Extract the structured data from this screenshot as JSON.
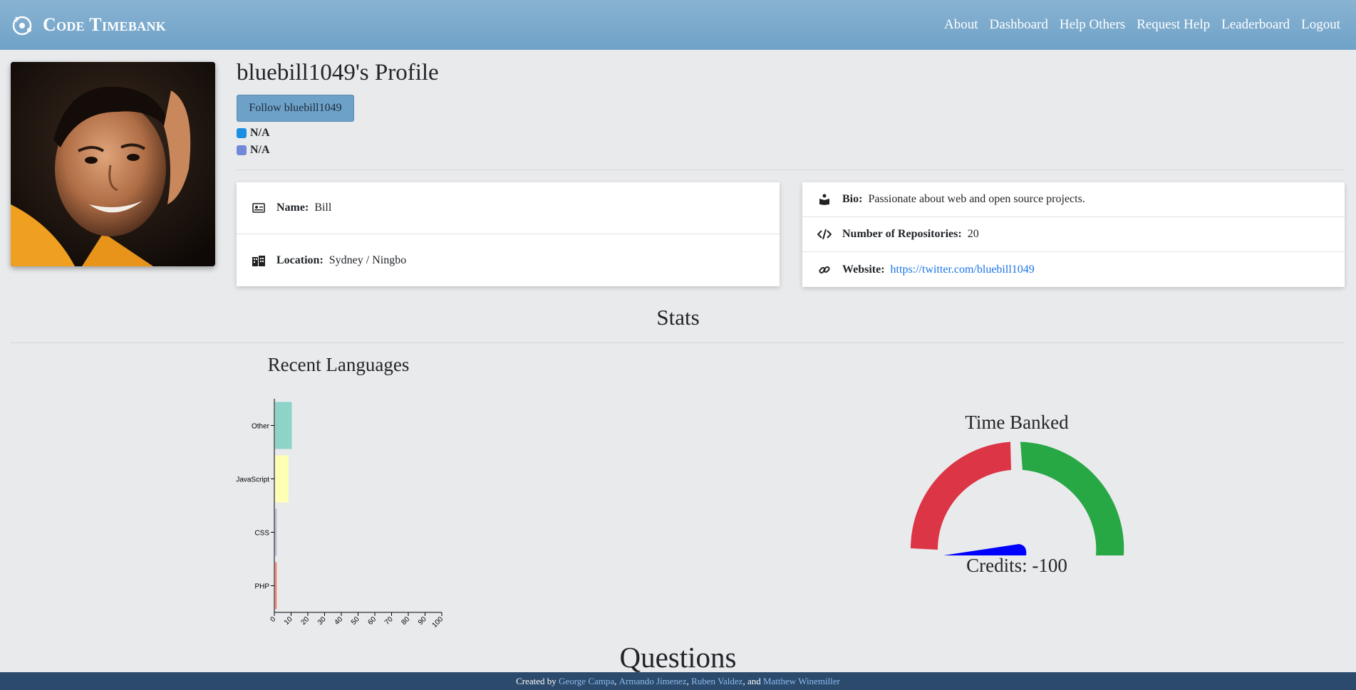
{
  "brand": {
    "name": "Code Timebank"
  },
  "nav": {
    "items": [
      "About",
      "Dashboard",
      "Help Others",
      "Request Help",
      "Leaderboard",
      "Logout"
    ]
  },
  "profile": {
    "title": "bluebill1049's Profile",
    "follow_label": "Follow bluebill1049",
    "skype": "N/A",
    "discord": "N/A"
  },
  "info_left": {
    "name_label": "Name:",
    "name_value": "Bill",
    "location_label": "Location:",
    "location_value": "Sydney / Ningbo"
  },
  "info_right": {
    "bio_label": "Bio:",
    "bio_value": "Passionate about web and open source projects.",
    "repos_label": "Number of Repositories:",
    "repos_value": "20",
    "website_label": "Website:",
    "website_value": "https://twitter.com/bluebill1049"
  },
  "stats": {
    "title": "Stats"
  },
  "colors": {
    "navbar": "#7aaacd",
    "link": "#1a73e8",
    "gauge_red": "#dc3545",
    "gauge_green": "#28a745",
    "needle": "#0000ff",
    "footer": "#2b4a6c"
  },
  "chart_data": [
    {
      "type": "bar",
      "orientation": "horizontal",
      "title": "Recent Languages",
      "categories": [
        "Other",
        "JavaScript",
        "CSS",
        "PHP"
      ],
      "values": [
        10,
        8,
        1,
        1
      ],
      "colors": [
        "#8dd3c7",
        "#ffffb3",
        "#bebada",
        "#fb8072"
      ],
      "xlim": [
        0,
        100
      ],
      "xticks": [
        "0",
        "10",
        "20",
        "30",
        "40",
        "50",
        "60",
        "70",
        "80",
        "90",
        "100"
      ]
    },
    {
      "type": "gauge",
      "title": "Time Banked",
      "label": "Credits: -100",
      "value": -100,
      "segments": [
        "red",
        "green"
      ]
    }
  ],
  "questions": {
    "title": "Questions"
  },
  "footer": {
    "prefix": "Created by",
    "authors": [
      "George Campa",
      "Armando Jimenez",
      "Ruben Valdez",
      "Matthew Winemiller"
    ],
    "sep": ",",
    "and": ", and"
  }
}
